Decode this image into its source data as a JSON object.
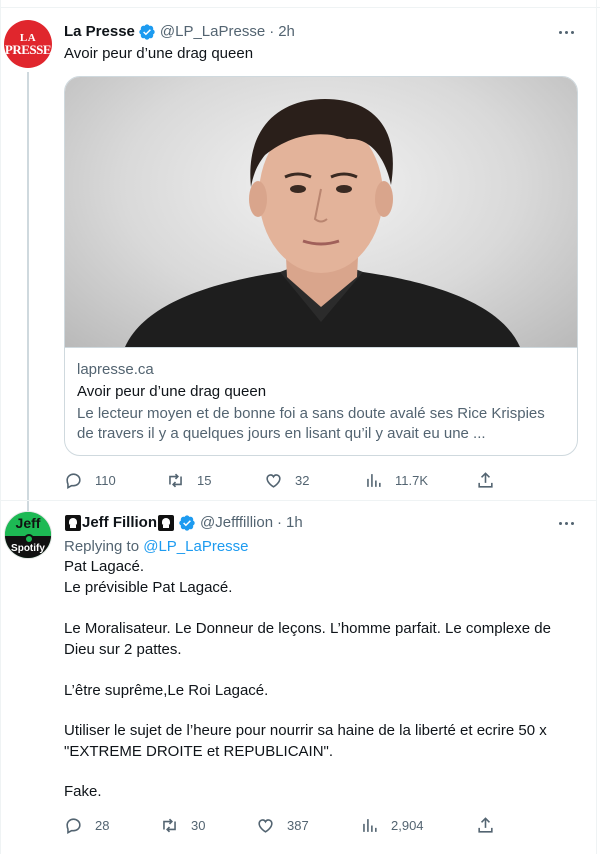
{
  "tweets": [
    {
      "author_name": "La Presse",
      "handle": "@LP_LaPresse",
      "separator": "·",
      "time": "2h",
      "avatar_logo": {
        "line1": "LA",
        "line2": "PRESSE"
      },
      "text": "Avoir peur d’une drag queen",
      "card": {
        "domain": "lapresse.ca",
        "title": "Avoir peur d’une drag queen",
        "description": "Le lecteur moyen et de bonne foi a sans doute avalé ses Rice Krispies de travers il y a quelques jours en lisant qu’il y avait eu une ..."
      },
      "actions": {
        "replies": "110",
        "retweets": "15",
        "likes": "32",
        "views": "11.7K"
      }
    },
    {
      "author_name": "Jeff Fillion",
      "handle": "@Jefffillion",
      "separator": "·",
      "time": "1h",
      "avatar_logo": {
        "top": "Jeff",
        "bottom": "Spotify"
      },
      "replying_prefix": "Replying to",
      "replying_to": "@LP_LaPresse",
      "lines": [
        "Pat Lagacé.",
        "Le prévisible Pat Lagacé.",
        "Le Moralisateur. Le Donneur de leçons. L’homme parfait. Le complexe de",
        "Dieu sur 2 pattes.",
        "L’être suprême,Le Roi Lagacé.",
        "Utiliser le sujet de l’heure pour nourrir sa haine de la liberté et ecrire 50 x",
        "\"EXTREME DROITE et REPUBLICAIN\".",
        "Fake."
      ],
      "actions": {
        "replies": "28",
        "retweets": "30",
        "likes": "387",
        "views": "2,904"
      }
    }
  ],
  "colors": {
    "accent": "#1d9bf0",
    "secondary_text": "#536471",
    "verified": "#1d9bf0",
    "lapresse_red": "#e0262d",
    "spotify_green": "#1db954"
  },
  "icons": [
    "verified-badge-icon",
    "more-icon",
    "reply-icon",
    "retweet-icon",
    "like-icon",
    "views-icon",
    "share-icon"
  ]
}
